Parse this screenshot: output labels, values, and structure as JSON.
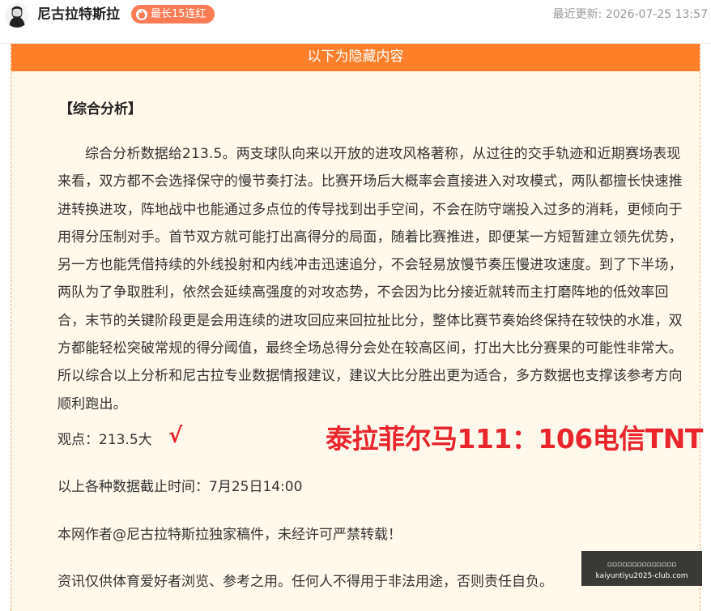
{
  "header": {
    "author": "尼古拉特斯拉",
    "streak_badge": "最长15连红",
    "updated_label": "最近更新:",
    "updated_time": "2026-07-25 13:57"
  },
  "hidden_banner": "以下为隐藏内容",
  "analysis": {
    "title": "【综合分析】",
    "body": "综合分析数据给213.5。两支球队向来以开放的进攻风格著称，从过往的交手轨迹和近期赛场表现来看，双方都不会选择保守的慢节奏打法。比赛开场后大概率会直接进入对攻模式，两队都擅长快速推进转换进攻，阵地战中也能通过多点位的传导找到出手空间，不会在防守端投入过多的消耗，更倾向于用得分压制对手。首节双方就可能打出高得分的局面，随着比赛推进，即便某一方短暂建立领先优势，另一方也能凭借持续的外线投射和内线冲击迅速追分，不会轻易放慢节奏压慢进攻速度。到了下半场，两队为了争取胜利，依然会延续高强度的对攻态势，不会因为比分接近就转而主打磨阵地的低效率回合，末节的关键阶段更是会用连续的进攻回应来回拉扯比分，整体比赛节奏始终保持在较快的水准，双方都能轻松突破常规的得分阈值，最终全场总得分会处在较高区间，打出大比分赛果的可能性非常大。所以综合以上分析和尼古拉专业数据情报建议，建议大比分胜出更为适合，多方数据也支撑该参考方向顺利跑出。",
    "view": "观点：213.5大",
    "check_mark": "√",
    "result": "泰拉菲尔马111：106电信TNT",
    "cutoff": "以上各种数据截止时间：7月25日14:00",
    "copyright": "本网作者@尼古拉特斯拉独家稿件，未经许可严禁转载！",
    "disclaimer": "资讯仅供体育爱好者浏览、参考之用。任何人不得用于非法用途，否则责任自负。"
  },
  "watermark": {
    "line1": "▫▫▫▫▫▫▫▫▫▫▫▫▫▫",
    "line2": "kaiyuntiyu2025-club.com"
  },
  "colors": {
    "accent": "#ff7f2a",
    "result_red": "#e8262c",
    "panel_bg": "#fff8eb"
  }
}
